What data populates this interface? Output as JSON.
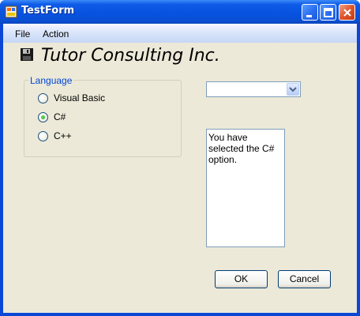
{
  "window": {
    "title": "TestForm"
  },
  "menu": {
    "file": "File",
    "action": "Action"
  },
  "header": {
    "title": "Tutor Consulting Inc."
  },
  "language_group": {
    "legend": "Language",
    "options": [
      {
        "label": "Visual Basic",
        "selected": false
      },
      {
        "label": "C#",
        "selected": true
      },
      {
        "label": "C++",
        "selected": false
      }
    ]
  },
  "combo": {
    "value": ""
  },
  "output": {
    "text": "You have selected the C# option."
  },
  "buttons": {
    "ok": "OK",
    "cancel": "Cancel"
  },
  "colors": {
    "titlebar": "#0752df",
    "face": "#ece9d8",
    "accent": "#0046d5"
  }
}
